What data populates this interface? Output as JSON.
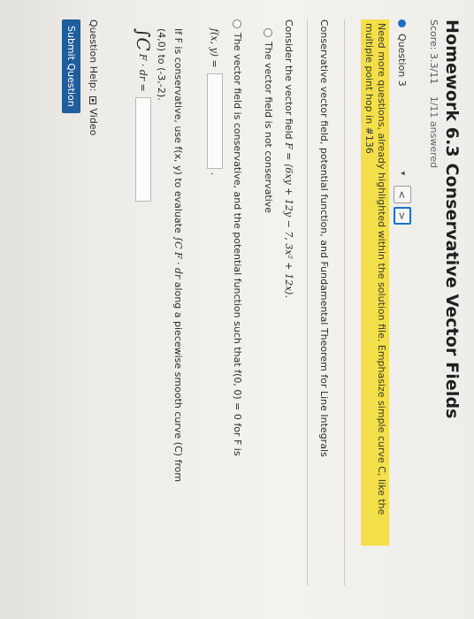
{
  "header": {
    "title": "Homework 6.3 Conservative Vector Fields",
    "score": "Score: 3.3/11",
    "answered": "1/11 answered"
  },
  "question_nav": {
    "current": "Question 3",
    "dropdown_glyph": "▾",
    "prev_label": "<",
    "next_label": ">"
  },
  "notice": "Need more questions, already highlighted within the solution file.  Emphasize simple curve C, like the multiple point hop in #136",
  "section_title": "Conservative vector field, potential function, and Fundamental Theorem for Line Integrals",
  "question": {
    "consider_prefix": "Consider the vector field ",
    "field_expression": "F = ⟨6xy + 12y − 7, 3x² + 12x⟩.",
    "option_not_conservative": "The vector field is not conservative",
    "option_conservative": "The vector field is conservative, and the potential function such that f(0, 0) = 0 for F is",
    "f_label": "f(x, y) =",
    "f_trailing": ".",
    "use_text_a": "If F is conservative, use f(x, y) to evaluate ",
    "use_integral": "∫C F · dr",
    "use_text_b": " along a piecewise smooth curve (C) from",
    "path_text": "(4,0) to (-3,-2).",
    "integral_symbol": "∫C",
    "integral_expr": "F · dr ="
  },
  "footer": {
    "help_label": "Question Help:",
    "video_label": "Video",
    "submit_label": "Submit Question"
  },
  "colors": {
    "accent": "#1e6fc4",
    "highlight": "#f3df4a",
    "submit_bg": "#1f5e9c"
  }
}
